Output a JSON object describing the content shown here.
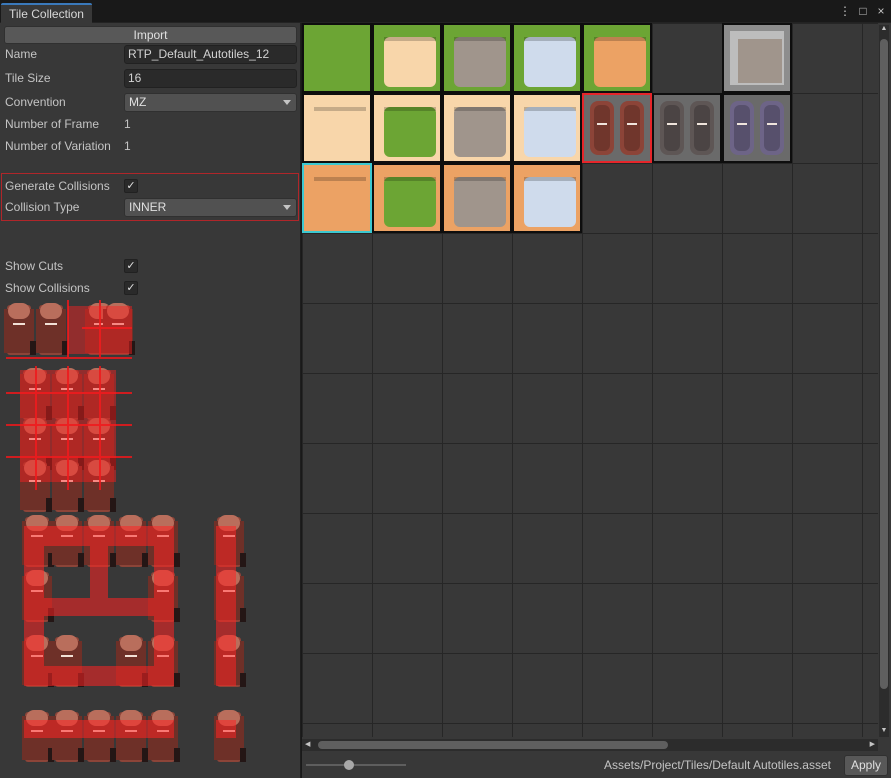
{
  "window": {
    "tab_title": "Tile Collection",
    "menu_icon": "⋮",
    "maximize_icon": "□",
    "close_icon": "×"
  },
  "inspector": {
    "import_label": "Import",
    "name_label": "Name",
    "name_value": "RTP_Default_Autotiles_12",
    "tile_size_label": "Tile Size",
    "tile_size_value": "16",
    "convention_label": "Convention",
    "convention_value": "MZ",
    "frames_label": "Number of Frame",
    "frames_value": "1",
    "variation_label": "Number of Variation",
    "variation_value": "1",
    "gen_collisions_label": "Generate Collisions",
    "gen_collisions_checked": true,
    "collision_type_label": "Collision Type",
    "collision_type_value": "INNER",
    "show_cuts_label": "Show Cuts",
    "show_cuts_checked": true,
    "show_collisions_label": "Show Collisions",
    "show_collisions_checked": true
  },
  "tiles": {
    "rows": [
      [
        "grass",
        "grass-sand-light",
        "grass-rock",
        "grass-snow",
        "grass-sand-dark",
        "empty",
        "stone-wall"
      ],
      [
        "sand-light",
        "sand-light-grass",
        "sand-light-rock",
        "sand-light-snow",
        "pillar-red",
        "pillar-gray",
        "pillar-purple"
      ],
      [
        "sand-dark",
        "sand-dark-grass",
        "sand-dark-rock",
        "sand-dark-snow",
        "empty",
        "empty",
        "empty"
      ]
    ],
    "selected": "pillar-red",
    "hovered": "sand-dark",
    "colors": {
      "grass": "#6ca534",
      "sand_light": "#f8d6aa",
      "sand_dark": "#eca264",
      "rock": "#a0958c",
      "snow": "#cfdbec",
      "pillar_red": "#8c4438",
      "pillar_gray": "#5e5655",
      "pillar_purple": "#6d6487",
      "selected_border": "#e6252a",
      "hover_border": "#3cc8d0"
    }
  },
  "footer": {
    "asset_path": "Assets/Project/Tiles/Default Autotiles.asset",
    "apply_label": "Apply"
  }
}
